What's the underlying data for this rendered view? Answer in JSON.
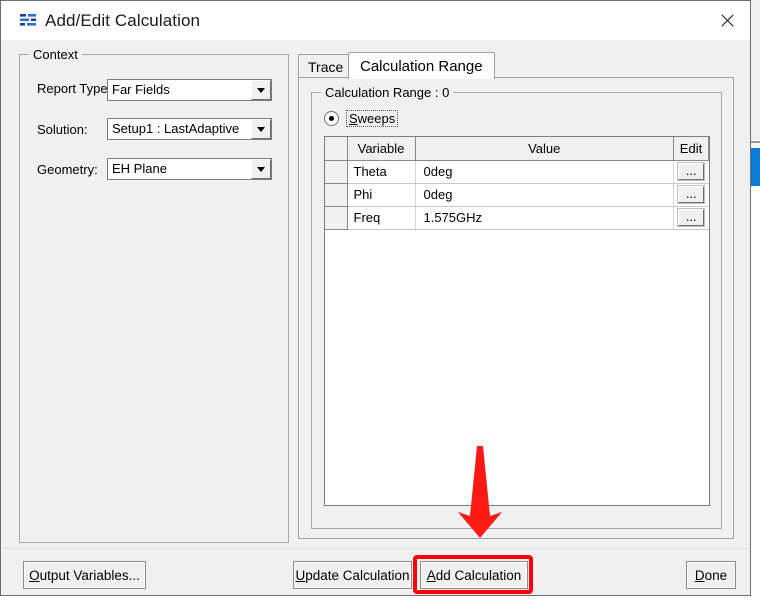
{
  "window": {
    "title": "Add/Edit Calculation",
    "icon": "calculation-icon",
    "close_label": "✕"
  },
  "context": {
    "legend": "Context",
    "fields": [
      {
        "label": "Report Type:",
        "value": "Far Fields",
        "name": "report-type"
      },
      {
        "label": "Solution:",
        "value": "Setup1 : LastAdaptive",
        "name": "solution"
      },
      {
        "label": "Geometry:",
        "value": "EH Plane",
        "name": "geometry"
      }
    ]
  },
  "tabs": [
    {
      "label": "Trace",
      "active": false
    },
    {
      "label": "Calculation Range",
      "active": true
    }
  ],
  "calculation_range": {
    "legend": "Calculation Range : 0",
    "radio": {
      "label_prefix": "S",
      "label_rest": "weeps",
      "label": "Sweeps",
      "selected": true
    },
    "table": {
      "columns": [
        "",
        "Variable",
        "Value",
        "Edit"
      ],
      "rows": [
        {
          "variable": "Theta",
          "value": "0deg",
          "edit": "..."
        },
        {
          "variable": "Phi",
          "value": "0deg",
          "edit": "..."
        },
        {
          "variable": "Freq",
          "value": "1.575GHz",
          "edit": "..."
        }
      ]
    }
  },
  "footer": {
    "output_variables": {
      "accel": "O",
      "rest": "utput Variables..."
    },
    "update_calculation": {
      "accel": "U",
      "rest": "pdate Calculation"
    },
    "add_calculation": {
      "accel": "A",
      "rest": "dd Calculation"
    },
    "done": {
      "accel": "D",
      "rest": "one"
    }
  },
  "annotation": {
    "highlight_color": "#fe0000",
    "arrow_color": "#fe1a14",
    "target": "Add Calculation"
  }
}
